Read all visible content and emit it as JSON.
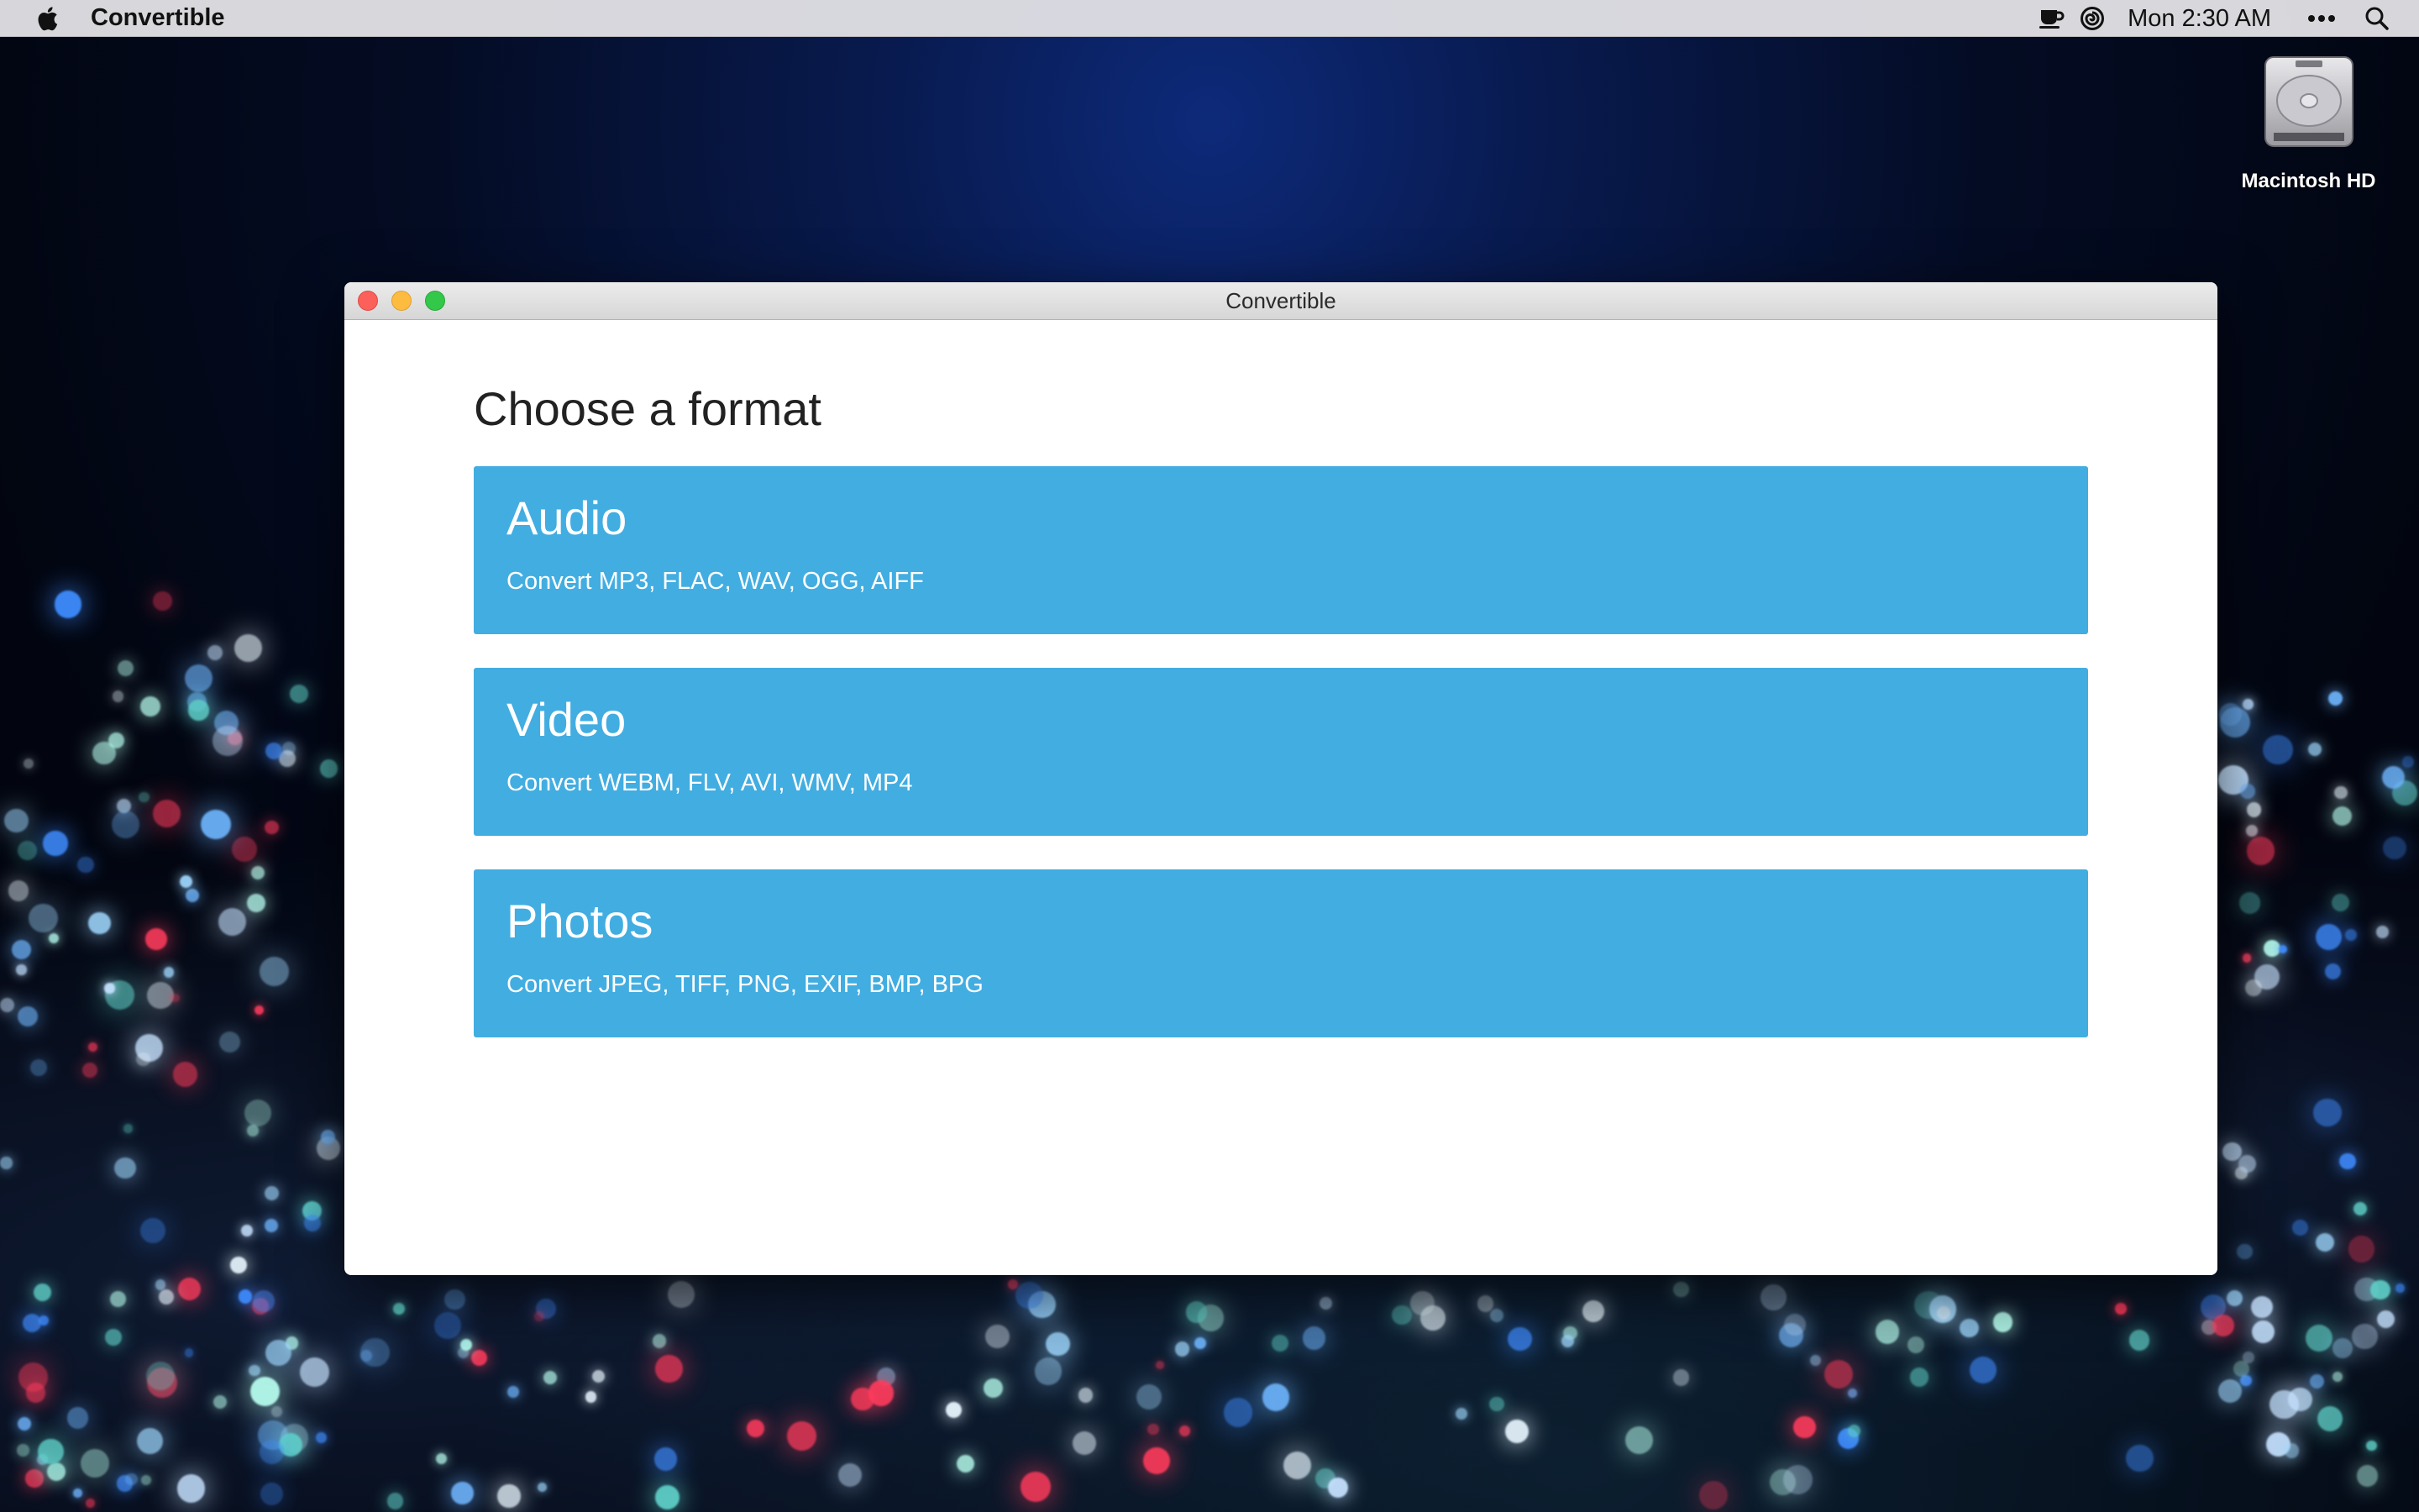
{
  "menubar": {
    "app_name": "Convertible",
    "clock": "Mon 2:30 AM",
    "icons": [
      "apple-icon",
      "coffee-cup-icon",
      "spiral-icon",
      "more-icon",
      "search-icon"
    ]
  },
  "desktop": {
    "disk_label": "Macintosh HD"
  },
  "window": {
    "title": "Convertible",
    "heading": "Choose a format",
    "cards": [
      {
        "title": "Audio",
        "description": "Convert MP3, FLAC, WAV, OGG, AIFF"
      },
      {
        "title": "Video",
        "description": "Convert WEBM, FLV, AVI, WMV, MP4"
      },
      {
        "title": "Photos",
        "description": "Convert JPEG, TIFF, PNG, EXIF, BMP, BPG"
      }
    ]
  },
  "colors": {
    "card": "#42ade1",
    "close": "#fc605b",
    "minimize": "#fdbc40",
    "zoom": "#34c84a"
  }
}
